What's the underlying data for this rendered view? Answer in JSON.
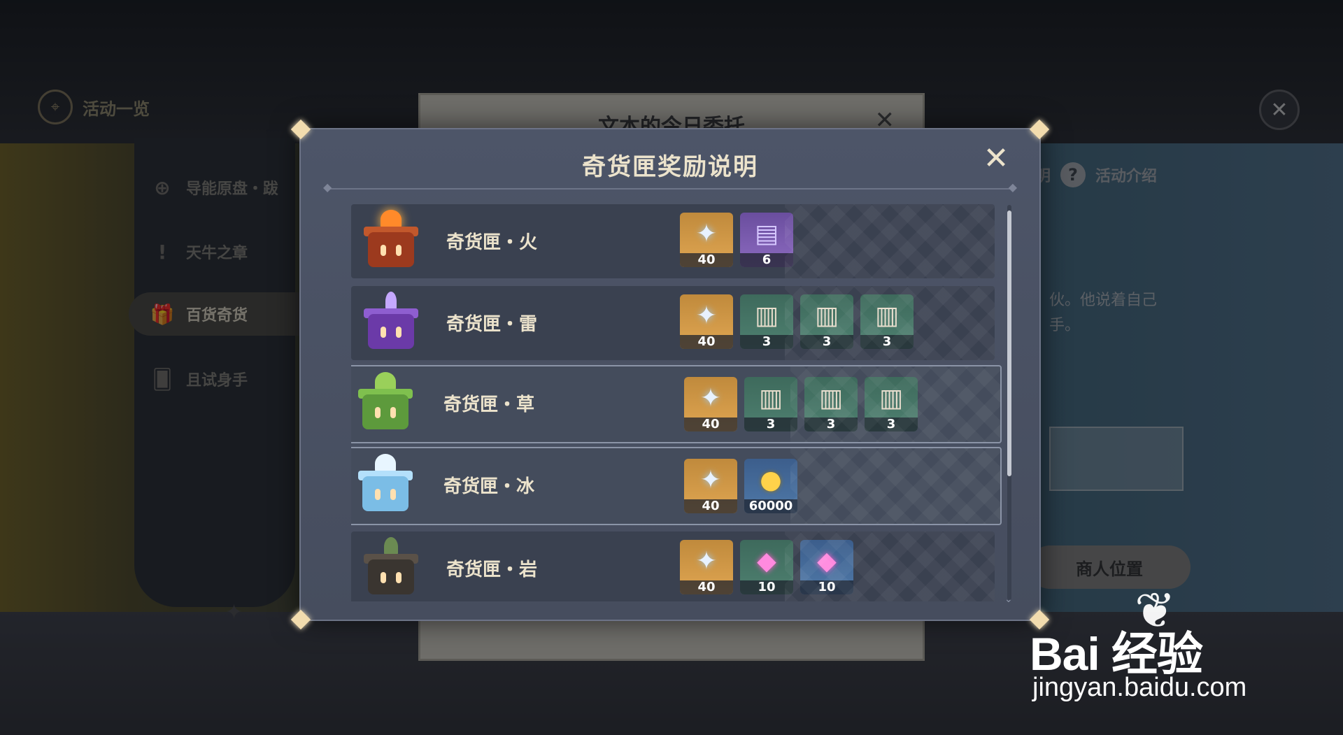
{
  "topbar": {
    "title": "活动一览",
    "close_icon": "close-icon"
  },
  "sidebar": {
    "items": [
      {
        "label": "导能原盘・跋",
        "icon": "target-icon"
      },
      {
        "label": "天牛之章",
        "icon": "exclamation-icon"
      },
      {
        "label": "百货奇货",
        "icon": "gift-icon",
        "active": true
      },
      {
        "label": "且试身手",
        "icon": "cards-icon"
      }
    ]
  },
  "paper": {
    "title": "文本的今日委托"
  },
  "right_panel": {
    "tab_partial": "明",
    "tab_intro": "活动介绍",
    "text_line1": "伙。他说着自己",
    "text_line2": "手。",
    "merchant_button": "商人位置"
  },
  "dialog": {
    "title": "奇货匣奖励说明",
    "rows": [
      {
        "name": "奇货匣・火",
        "box": "fire",
        "rewards": [
          {
            "icon": "star",
            "count": "40",
            "quality": "gold"
          },
          {
            "icon": "book",
            "count": "6",
            "quality": "purple"
          }
        ]
      },
      {
        "name": "奇货匣・雷",
        "box": "thunder",
        "rewards": [
          {
            "icon": "star",
            "count": "40",
            "quality": "gold"
          },
          {
            "icon": "tome",
            "count": "3",
            "quality": "green"
          },
          {
            "icon": "tome",
            "count": "3",
            "quality": "green"
          },
          {
            "icon": "tome",
            "count": "3",
            "quality": "green"
          }
        ]
      },
      {
        "name": "奇货匣・草",
        "box": "grass",
        "highlight": true,
        "rewards": [
          {
            "icon": "star",
            "count": "40",
            "quality": "gold"
          },
          {
            "icon": "tome",
            "count": "3",
            "quality": "green"
          },
          {
            "icon": "tome",
            "count": "3",
            "quality": "green"
          },
          {
            "icon": "tome",
            "count": "3",
            "quality": "green"
          }
        ]
      },
      {
        "name": "奇货匣・冰",
        "box": "ice",
        "highlight": true,
        "rewards": [
          {
            "icon": "star",
            "count": "40",
            "quality": "gold"
          },
          {
            "icon": "coin",
            "count": "60000",
            "quality": "blue"
          }
        ]
      },
      {
        "name": "奇货匣・岩",
        "box": "rock",
        "rewards": [
          {
            "icon": "star",
            "count": "40",
            "quality": "gold"
          },
          {
            "icon": "crystal",
            "count": "10",
            "quality": "green"
          },
          {
            "icon": "crystal",
            "count": "10",
            "quality": "blue"
          }
        ]
      }
    ]
  },
  "watermark": {
    "brand": "Bai 经验",
    "url": "jingyan.baidu.com"
  }
}
